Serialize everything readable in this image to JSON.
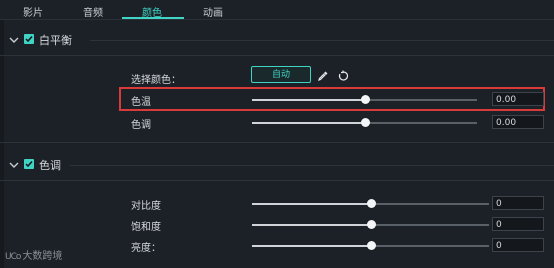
{
  "tabs": [
    {
      "label": "影片",
      "active": false
    },
    {
      "label": "音频",
      "active": false
    },
    {
      "label": "颜色",
      "active": true
    },
    {
      "label": "动画",
      "active": false
    }
  ],
  "white_balance": {
    "title": "白平衡",
    "checked": true,
    "pick_color_label": "选择颜色：",
    "auto_label": "自动",
    "rows": [
      {
        "label": "色温",
        "value": "0.00",
        "level": 0.5
      },
      {
        "label": "色调",
        "value": "0.00",
        "level": 0.5
      }
    ]
  },
  "tone": {
    "title": "色调",
    "checked": true,
    "rows": [
      {
        "label": "对比度",
        "value": "0",
        "level": 0.5
      },
      {
        "label": "饱和度",
        "value": "0",
        "level": 0.5
      },
      {
        "label": "亮度：",
        "value": "0",
        "level": 0.5
      }
    ]
  },
  "watermark": {
    "logo": "UCo",
    "text": "大数跨境"
  },
  "colors": {
    "accent": "#3fd4c4",
    "highlight": "#d93a3a",
    "background": "#1c2128"
  },
  "icons": [
    "chevron-down-icon",
    "checkbox-icon",
    "eyedropper-icon",
    "reset-icon"
  ]
}
